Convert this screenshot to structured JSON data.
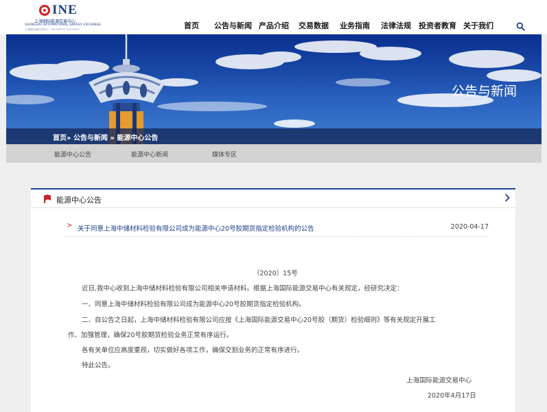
{
  "logo": {
    "mark_text": "INE",
    "cn_name": "上海国际能源交易中心",
    "en_name": "SHANGHAI INTERNATIONAL ENERGY EXCHANGE",
    "sub_text": "上海国际能源交易中心 · INE ENERGY EXCHANGE"
  },
  "nav": {
    "items": [
      "首页",
      "公告与新闻",
      "产品介绍",
      "交易数据",
      "业务指南",
      "法律法规",
      "投资者教育",
      "关于我们"
    ]
  },
  "banner": {
    "title": "公告与新闻",
    "breadcrumb": {
      "home": "首页",
      "sep": "»",
      "level1": "公告与新闻",
      "level2": "能源中心公告"
    }
  },
  "subtabs": [
    "能源中心公告",
    "能源中心新闻",
    "媒体专区"
  ],
  "panel": {
    "title": "能源中心公告",
    "notice": {
      "bullet": ">",
      "title": "关于同意上海中储材料检验有限公司成为能源中心20号胶期货指定检验机构的公告",
      "date": "2020-04-17"
    },
    "doc_no": "〔2020〕15号",
    "paragraphs": [
      "近日,我中心收到上海中储材料检验有限公司相关申请材料。根据上海国际能源交易中心有关规定，经研究决定：",
      "一、同意上海中储材料检验有限公司成为能源中心20号胶期货指定检验机构。",
      "二、自公告之日起，上海中储材料检验有限公司应按《上海国际能源交易中心20号胶（期货）检验细则》等有关规定开展工",
      "作、加强管理，确保20号胶期货检验业务正常有序运行。",
      "各有关单位应高度重视，切实做好各项工作，确保交割业务的正常有序进行。",
      "特此公告。"
    ],
    "signature": "上海国际能源交易中心",
    "sign_date": "2020年4月17日"
  },
  "colors": {
    "brand_blue": "#1d3f86",
    "brand_red": "#d21f26",
    "banner_blue": "#1a4aa8"
  },
  "icons": [
    "ine-logo-icon",
    "search-icon",
    "notice-flag-icon",
    "chevron-right-icon"
  ]
}
